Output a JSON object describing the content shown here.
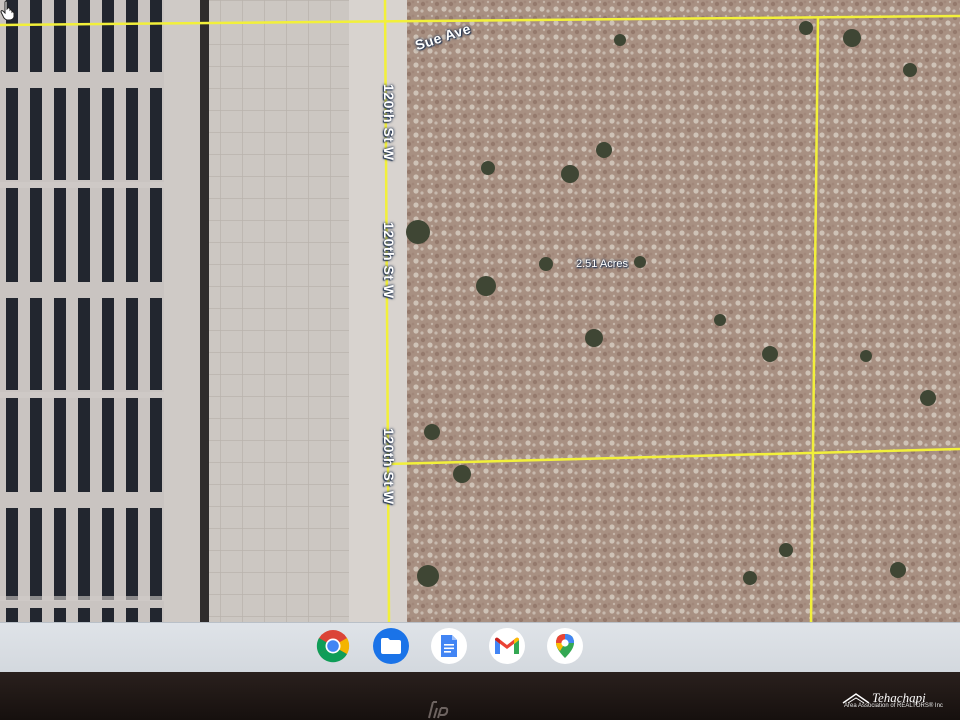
{
  "map": {
    "streets": {
      "sue_ave": "Sue Ave",
      "street_top": "120th St W",
      "street_mid": "120th St W",
      "street_bottom": "120th St W"
    },
    "parcel_label": "2.51 Acres",
    "parcel_line_color": "#f2f03a"
  },
  "shelf": {
    "apps": [
      {
        "name": "chrome-icon"
      },
      {
        "name": "files-icon"
      },
      {
        "name": "docs-icon"
      },
      {
        "name": "gmail-icon"
      },
      {
        "name": "maps-icon"
      }
    ]
  },
  "watermark": {
    "brand": "Tehachapi",
    "subtitle": "Area Association of REALTORS® Inc"
  }
}
